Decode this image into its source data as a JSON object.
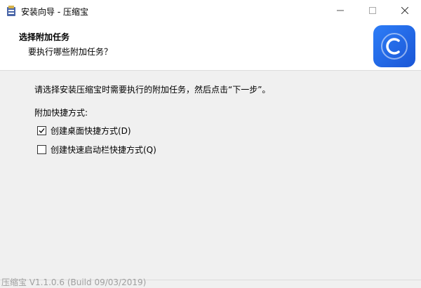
{
  "window": {
    "title": "安装向导 - 压缩宝",
    "controls": [
      "minimize-icon",
      "maximize-icon",
      "close-icon"
    ]
  },
  "header": {
    "title": "选择附加任务",
    "subtitle": "要执行哪些附加任务？"
  },
  "content": {
    "instruction": "请选择安装压缩宝时需要执行的附加任务，然后点击“下一步”。",
    "group_label": "附加快捷方式:",
    "options": [
      {
        "label": "创建桌面快捷方式(D)",
        "checked": true
      },
      {
        "label": "创建快速启动栏快捷方式(Q)",
        "checked": false
      }
    ]
  },
  "footer": {
    "version": "压缩宝 V1.1.0.6 (Build 09/03/2019)"
  },
  "colors": {
    "logo_bg": "#1a56d6",
    "background": "#f0f0f0"
  }
}
